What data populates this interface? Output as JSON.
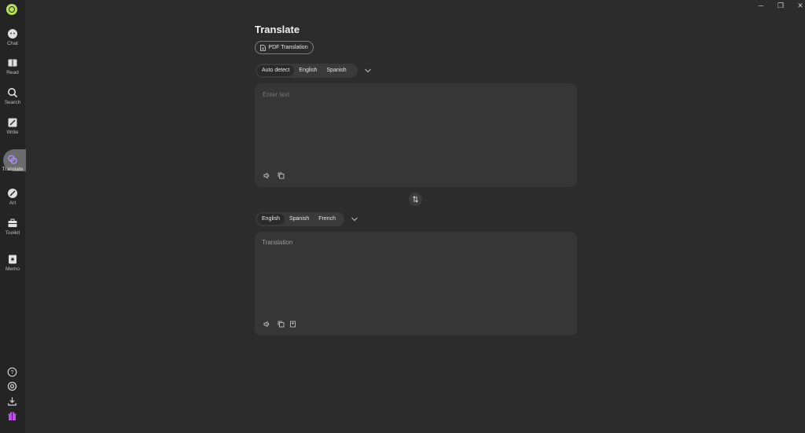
{
  "sidebar": {
    "items": [
      {
        "id": "chat",
        "label": "Chat"
      },
      {
        "id": "read",
        "label": "Read"
      },
      {
        "id": "search",
        "label": "Search"
      },
      {
        "id": "write",
        "label": "Write"
      },
      {
        "id": "translate",
        "label": "Translate"
      },
      {
        "id": "art",
        "label": "Art"
      },
      {
        "id": "toolkit",
        "label": "Toolkit"
      },
      {
        "id": "memo",
        "label": "Memo"
      }
    ],
    "active": "translate",
    "accent": "#a98bf5",
    "logo_color": "#b9e05b"
  },
  "window_controls": {
    "minimize": "─",
    "maximize": "❐",
    "close": "✕"
  },
  "page": {
    "title": "Translate",
    "pdf_button": "PDF Translation",
    "source": {
      "languages": [
        "Auto detect",
        "English",
        "Spanish"
      ],
      "selected": "Auto detect",
      "placeholder": "Enter text",
      "value": ""
    },
    "target": {
      "languages": [
        "English",
        "Spanish",
        "French"
      ],
      "selected": "English",
      "placeholder": "Translation"
    }
  }
}
